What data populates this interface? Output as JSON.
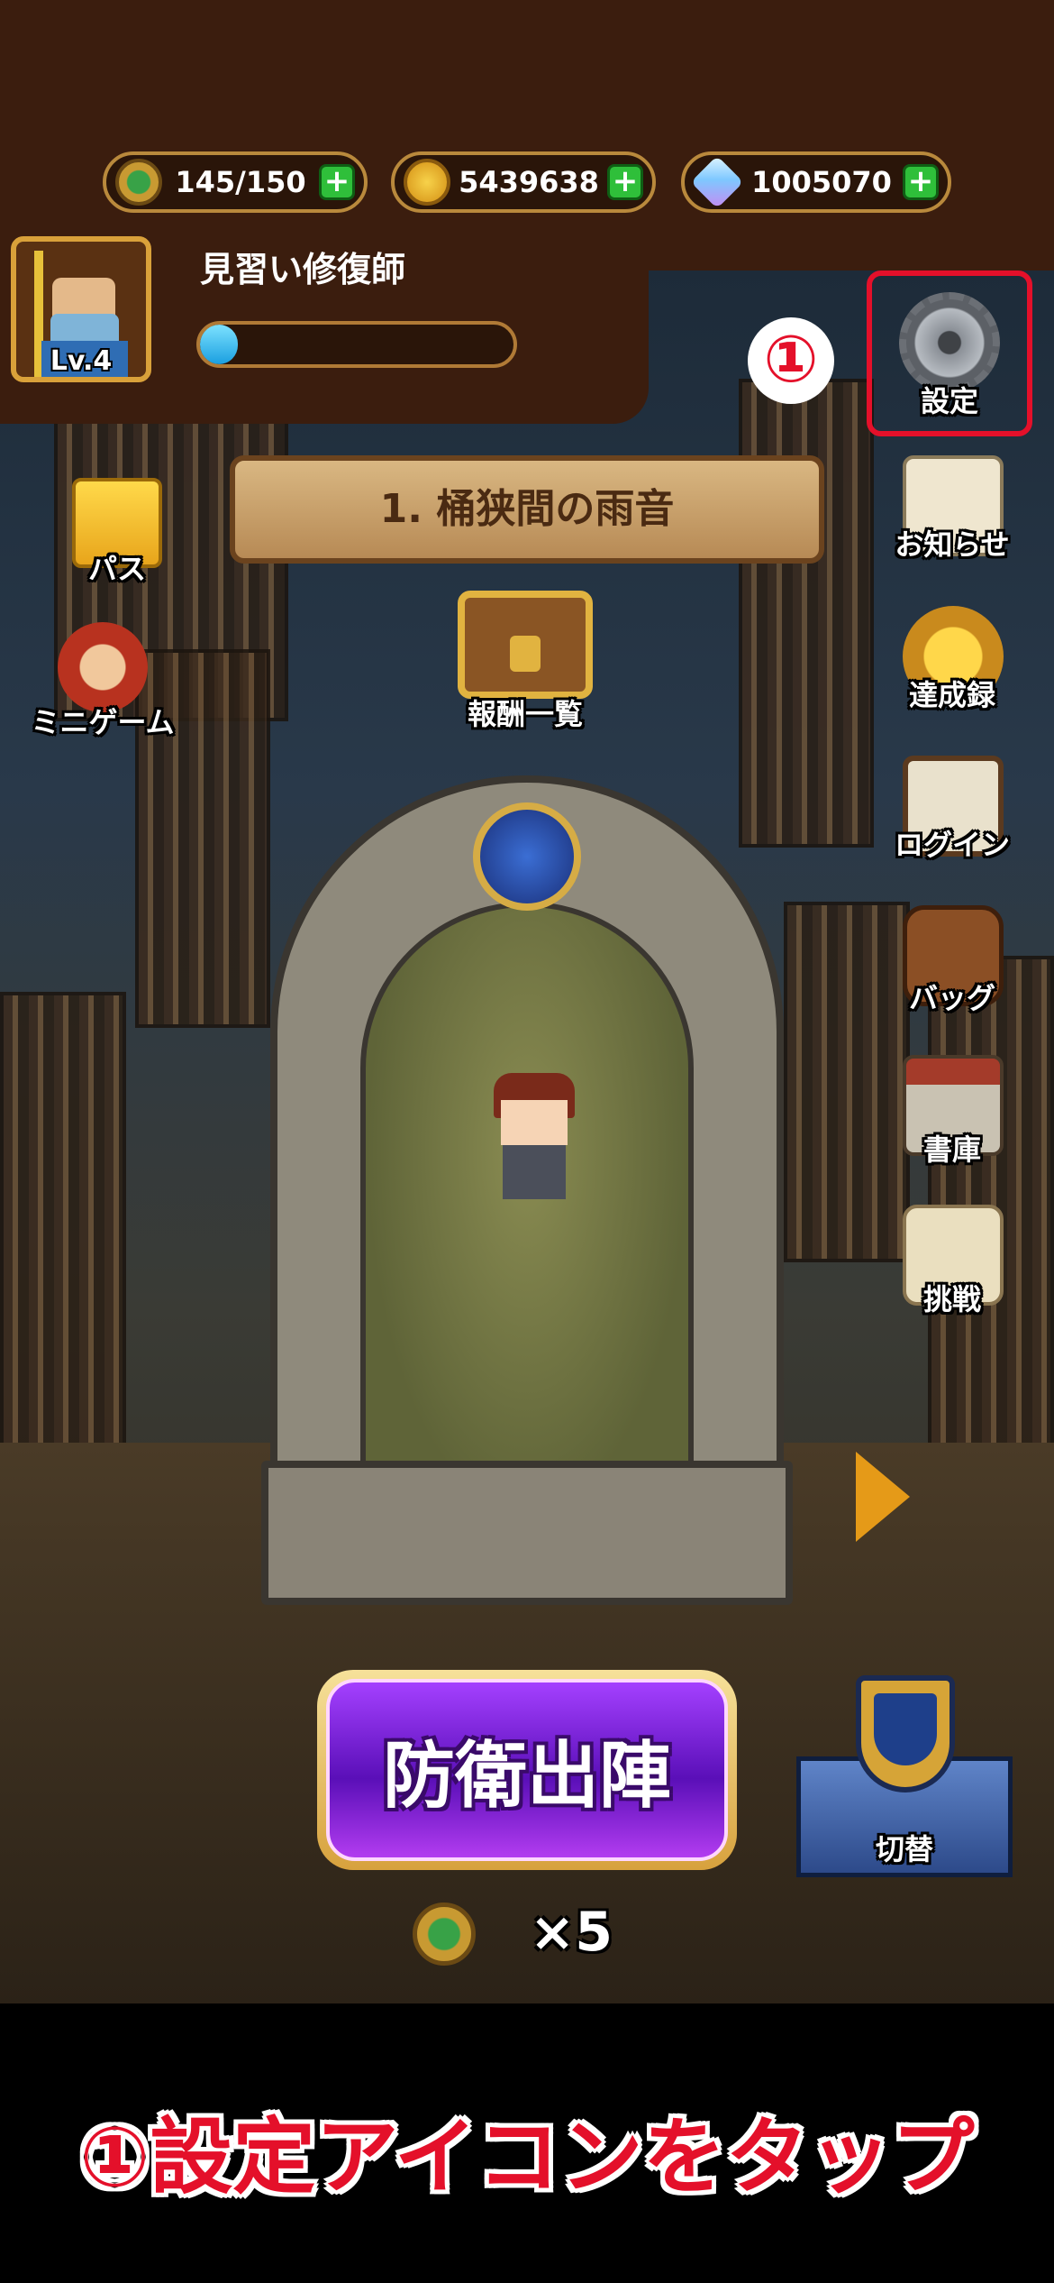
{
  "resources": {
    "stamina": "145/150",
    "coins": "5439638",
    "gems": "1005070"
  },
  "player": {
    "level": "Lv.4",
    "title": "見習い修復師",
    "xp_fraction": 0.12
  },
  "stage": {
    "name": "1. 桶狭間の雨音"
  },
  "left_menu": {
    "pass": "パス",
    "minigame": "ミニゲーム"
  },
  "rewards": {
    "label": "報酬一覧"
  },
  "side_menu": {
    "settings": "設定",
    "notice": "お知らせ",
    "achievements": "達成録",
    "login": "ログイン",
    "bag": "バッグ",
    "library": "書庫",
    "challenge": "挑戦"
  },
  "actions": {
    "sortie": "防衛出陣",
    "stamina_cost": "×5",
    "switch": "切替"
  },
  "annotation": {
    "marker": "①",
    "caption": "①設定アイコンをタップ"
  },
  "colors": {
    "highlight": "#e4102a",
    "panel": "#3b1d0e",
    "plus": "#2fbf3a"
  },
  "icons": {
    "stamina": "stopwatch-icon",
    "coins": "coin-icon",
    "gems": "crystal-icon",
    "settings": "gear-icon"
  }
}
